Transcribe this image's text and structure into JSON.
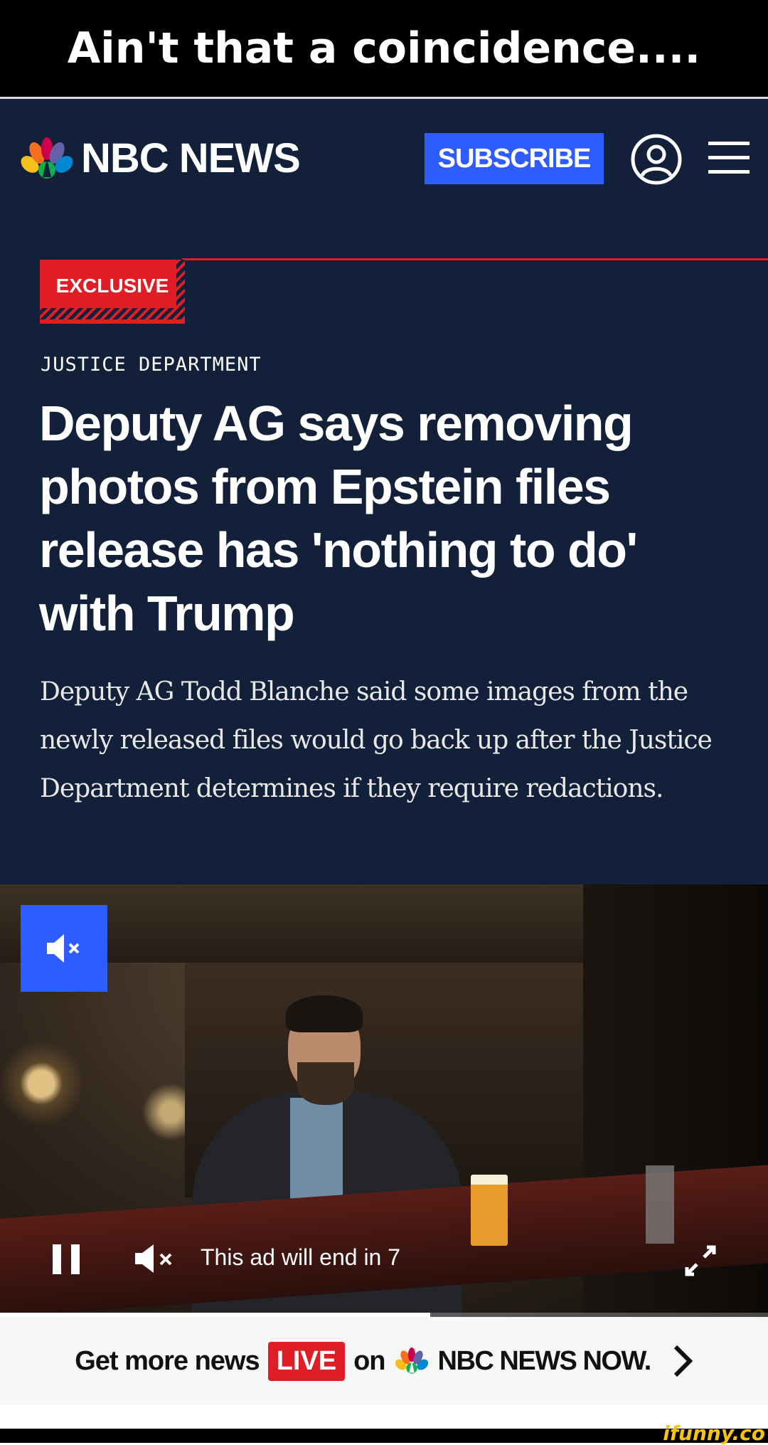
{
  "caption": {
    "text": "Ain't that a coincidence...."
  },
  "header": {
    "logo_text": "NBC NEWS",
    "subscribe_label": "SUBSCRIBE",
    "account_icon": "account-icon",
    "menu_icon": "hamburger-menu-icon"
  },
  "article": {
    "badge": "EXCLUSIVE",
    "section": "JUSTICE DEPARTMENT",
    "headline": "Deputy AG says removing photos from Epstein files release has 'nothing to do' with Trump",
    "dek": "Deputy AG Todd Blanche said some images from the newly released files would go back up after the Justice Department determines if they require redactions."
  },
  "video": {
    "ad_countdown": "This ad will end in 7",
    "progress_fraction": 0.56,
    "icons": [
      "unmute-icon",
      "pause-icon",
      "mute-icon",
      "fullscreen-icon"
    ]
  },
  "live_banner": {
    "prefix": "Get more news",
    "live": "LIVE",
    "on": "on",
    "brand": "NBC NEWS NOW."
  },
  "watermark": "ifunny.co",
  "colors": {
    "page_bg": "#12203a",
    "accent_blue": "#2e5cff",
    "exclusive_red": "#e01c24",
    "live_red": "#e01c24",
    "watermark_yellow": "#f7c30c"
  }
}
